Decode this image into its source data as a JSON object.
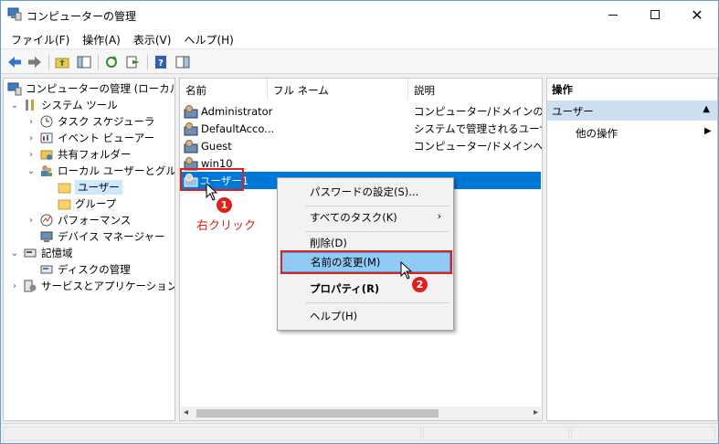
{
  "window": {
    "title": "コンピューターの管理"
  },
  "menu": [
    "ファイル(F)",
    "操作(A)",
    "表示(V)",
    "ヘルプ(H)"
  ],
  "tree": {
    "root": "コンピューターの管理 (ローカル)",
    "system_tools": "システム ツール",
    "task_scheduler": "タスク スケジューラ",
    "event_viewer": "イベント ビューアー",
    "shared_folders": "共有フォルダー",
    "local_users_groups": "ローカル ユーザーとグループ",
    "users": "ユーザー",
    "groups": "グループ",
    "performance": "パフォーマンス",
    "device_manager": "デバイス マネージャー",
    "storage": "記憶域",
    "disk_management": "ディスクの管理",
    "services_apps": "サービスとアプリケーション"
  },
  "list": {
    "columns": [
      "名前",
      "フル ネーム",
      "説明"
    ],
    "rows": [
      {
        "name": "Administrator",
        "desc": "コンピューター/ドメインの管理用"
      },
      {
        "name": "DefaultAcco...",
        "desc": "システムで管理されるユーザー"
      },
      {
        "name": "Guest",
        "desc": "コンピューター/ドメインへのゲスト"
      },
      {
        "name": "win10",
        "desc": ""
      },
      {
        "name": "ユーザー1",
        "desc": ""
      }
    ]
  },
  "actions": {
    "header": "操作",
    "section": "ユーザー",
    "more": "他の操作"
  },
  "context_menu": {
    "set_password": "パスワードの設定(S)...",
    "all_tasks": "すべてのタスク(K)",
    "delete": "削除(D)",
    "rename": "名前の変更(M)",
    "properties": "プロパティ(R)",
    "help": "ヘルプ(H)"
  },
  "annotations": {
    "step1": "1",
    "step1_text": "右クリック",
    "step2": "2"
  },
  "colors": {
    "selection": "#0078d7",
    "highlight": "#91c9f7",
    "annotation": "#e0201b"
  }
}
